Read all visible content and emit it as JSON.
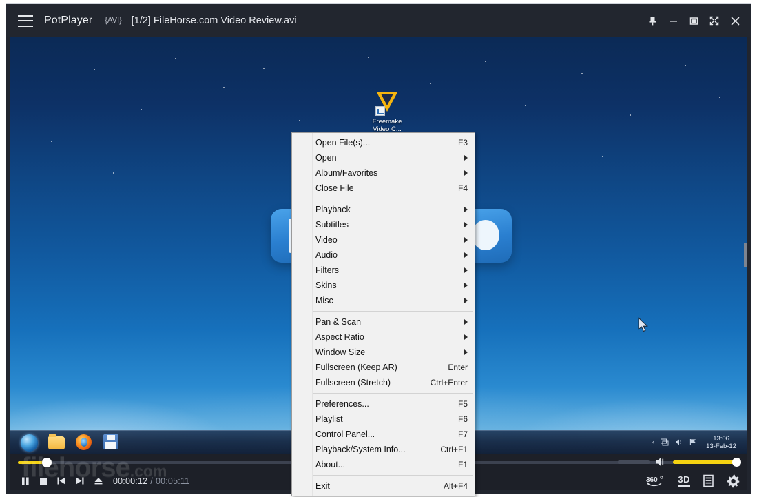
{
  "titlebar": {
    "menu_icon": "hamburger-icon",
    "app_name": "PotPlayer",
    "format_badge": "{AVI}",
    "file_title": "[1/2] FileHorse.com Video Review.avi",
    "controls": [
      {
        "name": "pin-button",
        "icon": "pin-icon",
        "tooltip": "Always on top"
      },
      {
        "name": "minimize-button",
        "icon": "minimize-icon",
        "tooltip": "Minimize"
      },
      {
        "name": "maximize-button",
        "icon": "maximize-icon",
        "tooltip": "Maximize"
      },
      {
        "name": "fullscreen-button",
        "icon": "expand-arrows-icon",
        "tooltip": "Fullscreen"
      },
      {
        "name": "close-button",
        "icon": "close-icon",
        "tooltip": "Close"
      }
    ]
  },
  "context_menu": {
    "groups": [
      [
        {
          "label": "Open File(s)...",
          "accel": "F3",
          "submenu": false
        },
        {
          "label": "Open",
          "accel": "",
          "submenu": true
        },
        {
          "label": "Album/Favorites",
          "accel": "",
          "submenu": true
        },
        {
          "label": "Close File",
          "accel": "F4",
          "submenu": false
        }
      ],
      [
        {
          "label": "Playback",
          "accel": "",
          "submenu": true
        },
        {
          "label": "Subtitles",
          "accel": "",
          "submenu": true
        },
        {
          "label": "Video",
          "accel": "",
          "submenu": true
        },
        {
          "label": "Audio",
          "accel": "",
          "submenu": true
        },
        {
          "label": "Filters",
          "accel": "",
          "submenu": true
        },
        {
          "label": "Skins",
          "accel": "",
          "submenu": true
        },
        {
          "label": "Misc",
          "accel": "",
          "submenu": true
        }
      ],
      [
        {
          "label": "Pan & Scan",
          "accel": "",
          "submenu": true
        },
        {
          "label": "Aspect Ratio",
          "accel": "",
          "submenu": true
        },
        {
          "label": "Window Size",
          "accel": "",
          "submenu": true
        },
        {
          "label": "Fullscreen (Keep AR)",
          "accel": "Enter",
          "submenu": false
        },
        {
          "label": "Fullscreen (Stretch)",
          "accel": "Ctrl+Enter",
          "submenu": false
        }
      ],
      [
        {
          "label": "Preferences...",
          "accel": "F5",
          "submenu": false
        },
        {
          "label": "Playlist",
          "accel": "F6",
          "submenu": false
        },
        {
          "label": "Control Panel...",
          "accel": "F7",
          "submenu": false
        },
        {
          "label": "Playback/System Info...",
          "accel": "Ctrl+F1",
          "submenu": false
        },
        {
          "label": "About...",
          "accel": "F1",
          "submenu": false
        }
      ],
      [
        {
          "label": "Exit",
          "accel": "Alt+F4",
          "submenu": false
        }
      ]
    ]
  },
  "video": {
    "desktop_icon": {
      "label_line1": "Freemake",
      "label_line2": "Video C...",
      "icon": "freemake-v-icon"
    },
    "taskbar": {
      "start_icon": "windows-orb-icon",
      "items": [
        {
          "name": "taskbar-explorer",
          "icon": "folder-icon"
        },
        {
          "name": "taskbar-firefox",
          "icon": "firefox-icon"
        },
        {
          "name": "taskbar-save",
          "icon": "floppy-disk-icon"
        }
      ],
      "tray_icons": [
        "show-hidden-icon",
        "network-icon",
        "volume-icon",
        "action-center-icon"
      ],
      "clock_time": "13:06",
      "clock_date": "13-Feb-12"
    }
  },
  "watermark": {
    "brand": "filehorse",
    "suffix": ".com"
  },
  "bottombar": {
    "seek": {
      "progress_percent": 4,
      "name": "seek-slider"
    },
    "volume": {
      "level_percent": 100,
      "icon": "speaker-icon",
      "name": "volume-slider"
    },
    "transport": [
      {
        "name": "pause-button",
        "icon": "pause-icon"
      },
      {
        "name": "stop-button",
        "icon": "stop-icon"
      },
      {
        "name": "previous-button",
        "icon": "previous-icon"
      },
      {
        "name": "next-button",
        "icon": "next-icon"
      },
      {
        "name": "eject-button",
        "icon": "eject-icon"
      }
    ],
    "time_current": "00:00:12",
    "time_separator": "/",
    "time_total": "00:05:11",
    "right_controls": [
      {
        "name": "vr-360-button",
        "label": "360",
        "icon": "vr-360-icon"
      },
      {
        "name": "three-d-button",
        "label": "3D",
        "icon": "3d-icon"
      },
      {
        "name": "playlist-button",
        "label": "",
        "icon": "playlist-icon"
      },
      {
        "name": "settings-button",
        "label": "",
        "icon": "gear-icon"
      }
    ]
  },
  "colors": {
    "chrome_dark": "#22262f",
    "bottom_bar": "#1d2028",
    "accent_yellow": "#f4d211",
    "menu_bg": "#f1f1f1",
    "menu_border": "#9a9a9a",
    "text_light": "#eef0f3"
  }
}
